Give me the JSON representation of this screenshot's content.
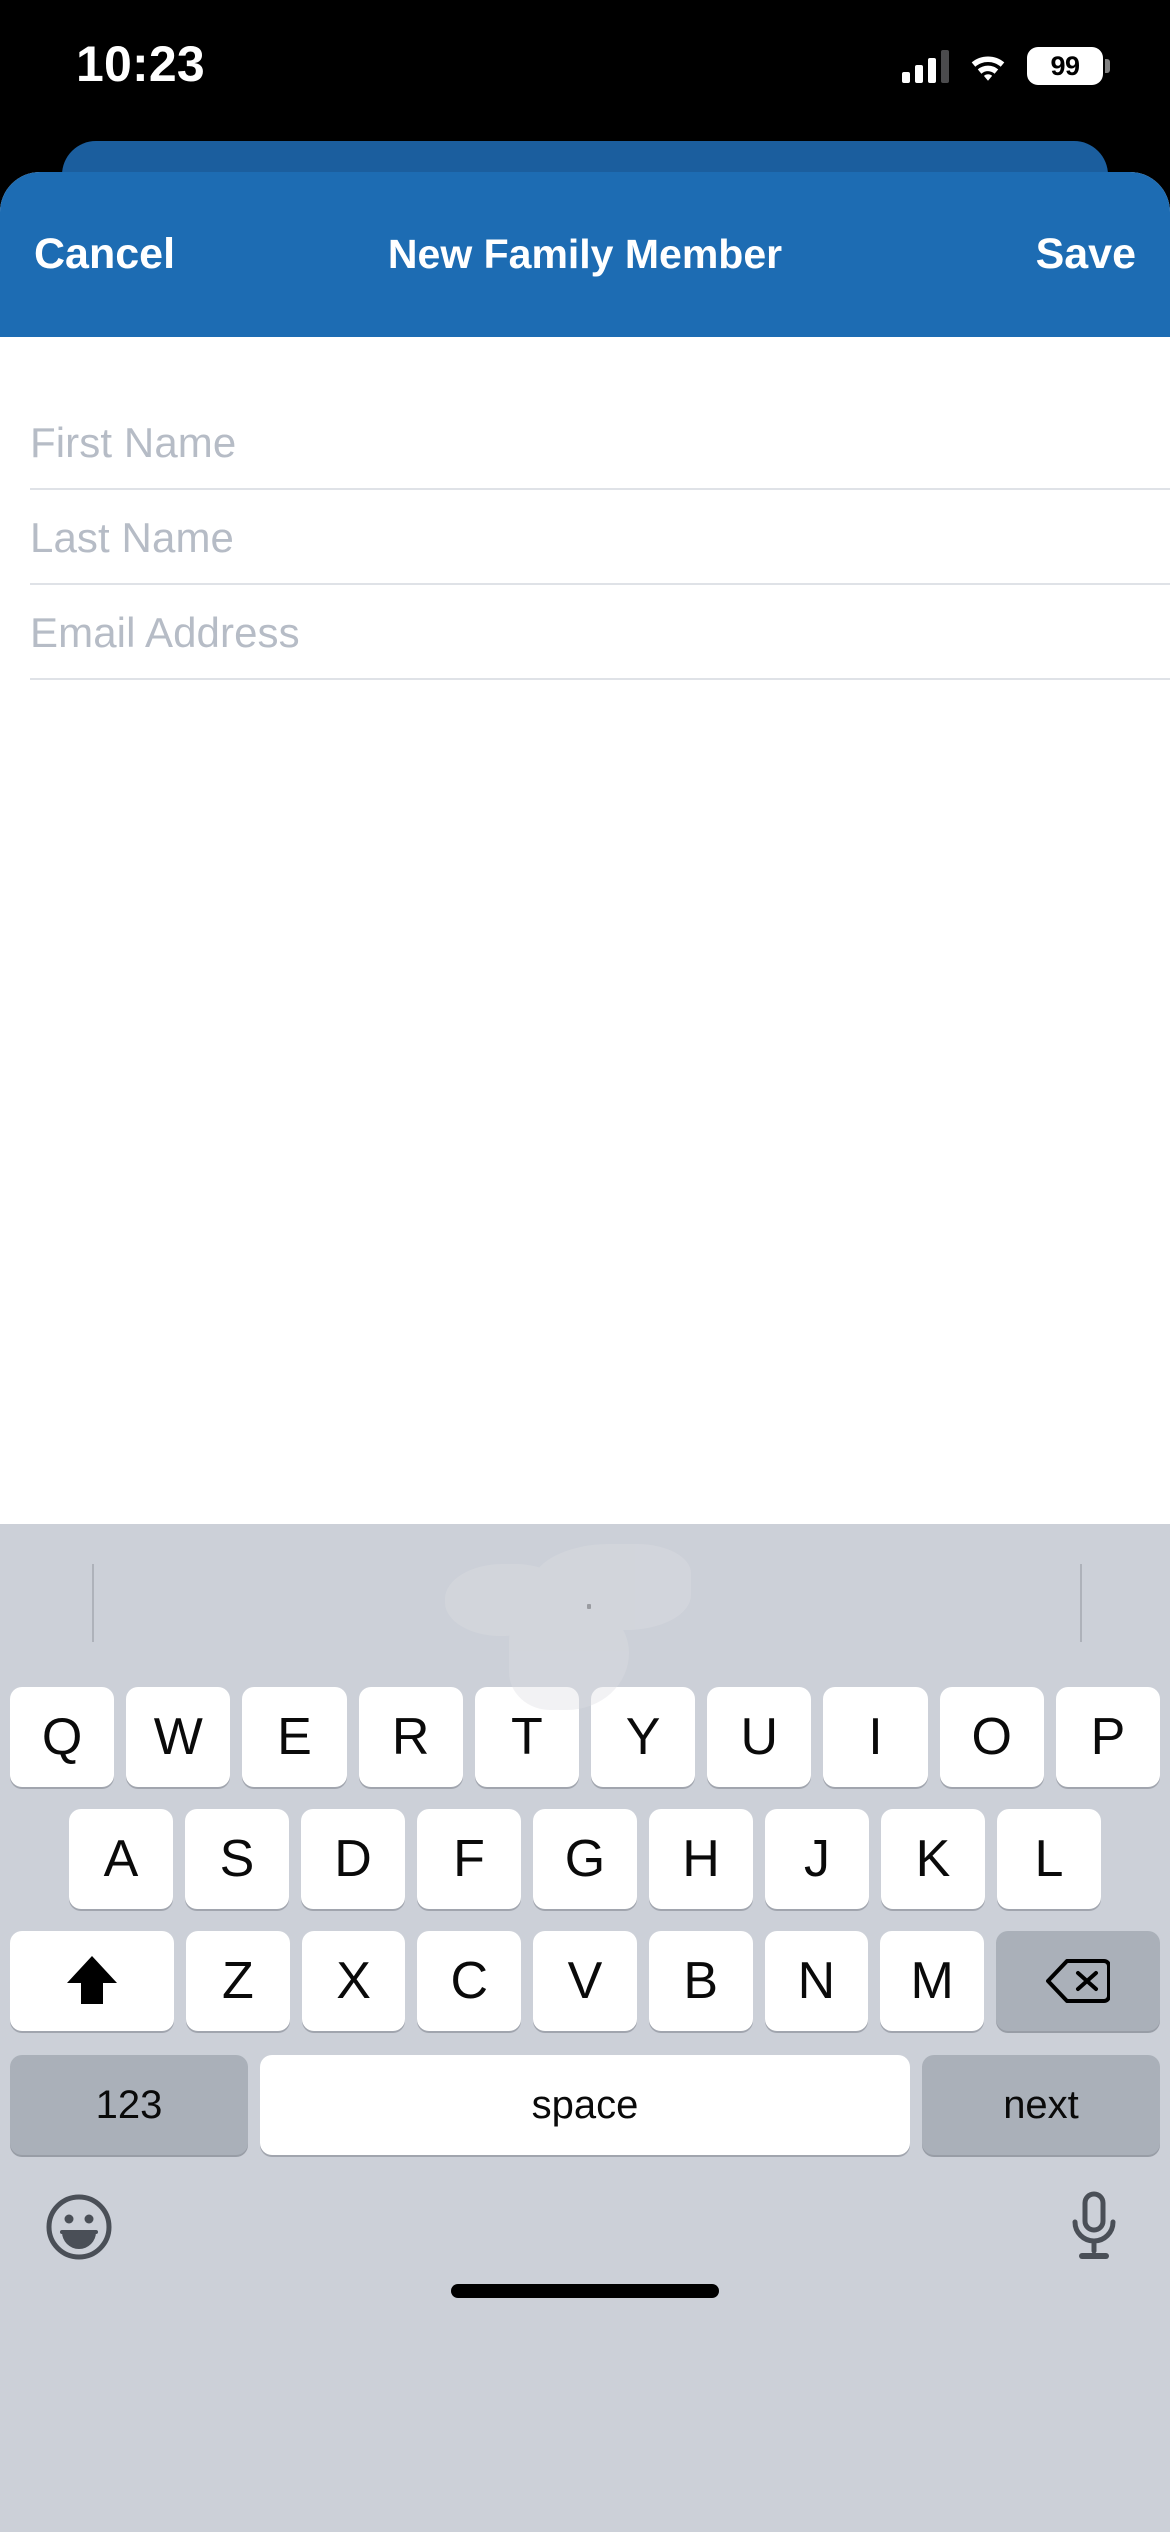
{
  "status_bar": {
    "time": "10:23",
    "battery_percent": "99",
    "cellular_icon": "cellular-bars-icon",
    "wifi_icon": "wifi-icon",
    "battery_icon": "battery-icon"
  },
  "nav_bar": {
    "cancel_label": "Cancel",
    "title": "New Family Member",
    "save_label": "Save",
    "background_color": "#1d6cb3",
    "text_color": "#ffffff"
  },
  "back_card": {
    "color": "#1b5e9e"
  },
  "form": {
    "fields": [
      {
        "name": "first-name",
        "placeholder": "First Name",
        "value": ""
      },
      {
        "name": "last-name",
        "placeholder": "Last Name",
        "value": ""
      },
      {
        "name": "email-address",
        "placeholder": "Email Address",
        "value": ""
      }
    ],
    "placeholder_color": "#b6bcc6",
    "separator_color": "#dfe2e7"
  },
  "keyboard": {
    "background_color": "#ccd0d8",
    "key_color": "#ffffff",
    "special_key_color": "#aab0b9",
    "row1": [
      "Q",
      "W",
      "E",
      "R",
      "T",
      "Y",
      "U",
      "I",
      "O",
      "P"
    ],
    "row2": [
      "A",
      "S",
      "D",
      "F",
      "G",
      "H",
      "J",
      "K",
      "L"
    ],
    "row3_letters": [
      "Z",
      "X",
      "C",
      "V",
      "B",
      "N",
      "M"
    ],
    "shift_icon": "shift-icon",
    "backspace_icon": "backspace-icon",
    "numbers_label": "123",
    "space_label": "space",
    "return_label": "next",
    "emoji_icon": "emoji-smiley-icon",
    "dictation_icon": "microphone-icon"
  }
}
